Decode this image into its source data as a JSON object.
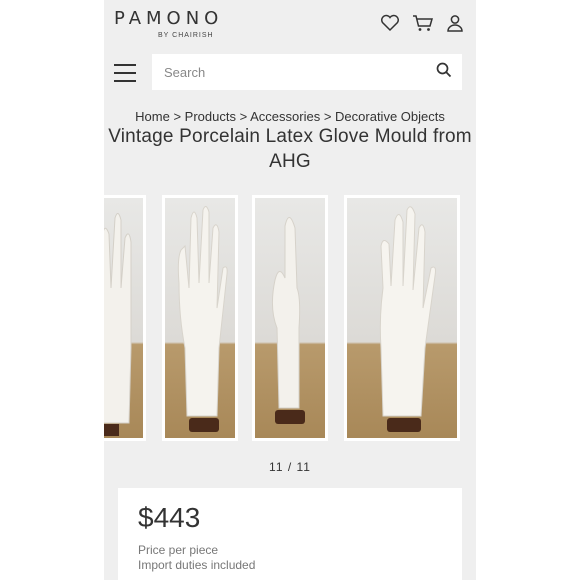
{
  "brand": {
    "name": "PAMONO",
    "sub": "BY CHAIRISH"
  },
  "header": {
    "icons": [
      "heart-icon",
      "cart-icon",
      "user-icon"
    ]
  },
  "search": {
    "placeholder": "Search"
  },
  "breadcrumb": {
    "items": [
      "Home",
      "Products",
      "Accessories",
      "Decorative Objects"
    ],
    "separator": ">"
  },
  "product": {
    "title": "Vintage Porcelain Latex Glove Mould from AHG"
  },
  "gallery": {
    "counter": "11 / 11"
  },
  "pricing": {
    "price": "$443",
    "note1": "Price per piece",
    "note2": "Import duties included"
  },
  "colors": {
    "background": "#efefef",
    "text": "#333333",
    "muted": "#777777"
  }
}
